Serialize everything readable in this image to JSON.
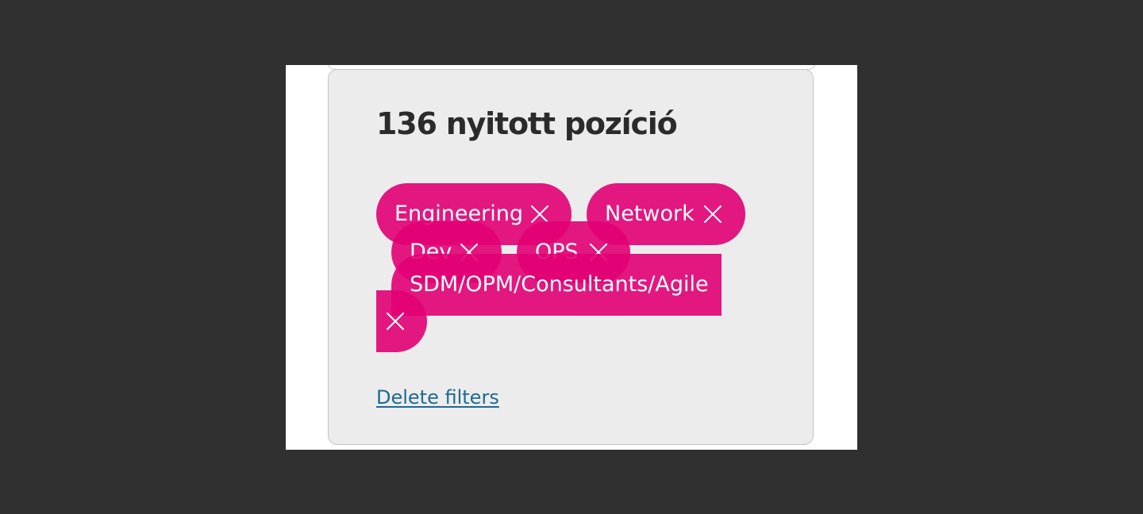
{
  "panel": {
    "title": "136 nyitott pozíció"
  },
  "filters": {
    "chips": [
      {
        "label": "Engineering",
        "icon": "close-icon"
      },
      {
        "label": "Network",
        "icon": "close-icon"
      },
      {
        "label": "Dev",
        "icon": "close-icon"
      },
      {
        "label": "OPS",
        "icon": "close-icon"
      },
      {
        "label": "SDM/OPM/Consultants/Agile",
        "icon": "close-icon"
      }
    ],
    "chip_color": "#e20074",
    "delete_label": "Delete filters"
  },
  "colors": {
    "page_background": "#303030",
    "panel_background": "#ececec",
    "title_text": "#2b2b2b",
    "link": "#1e6a93"
  }
}
